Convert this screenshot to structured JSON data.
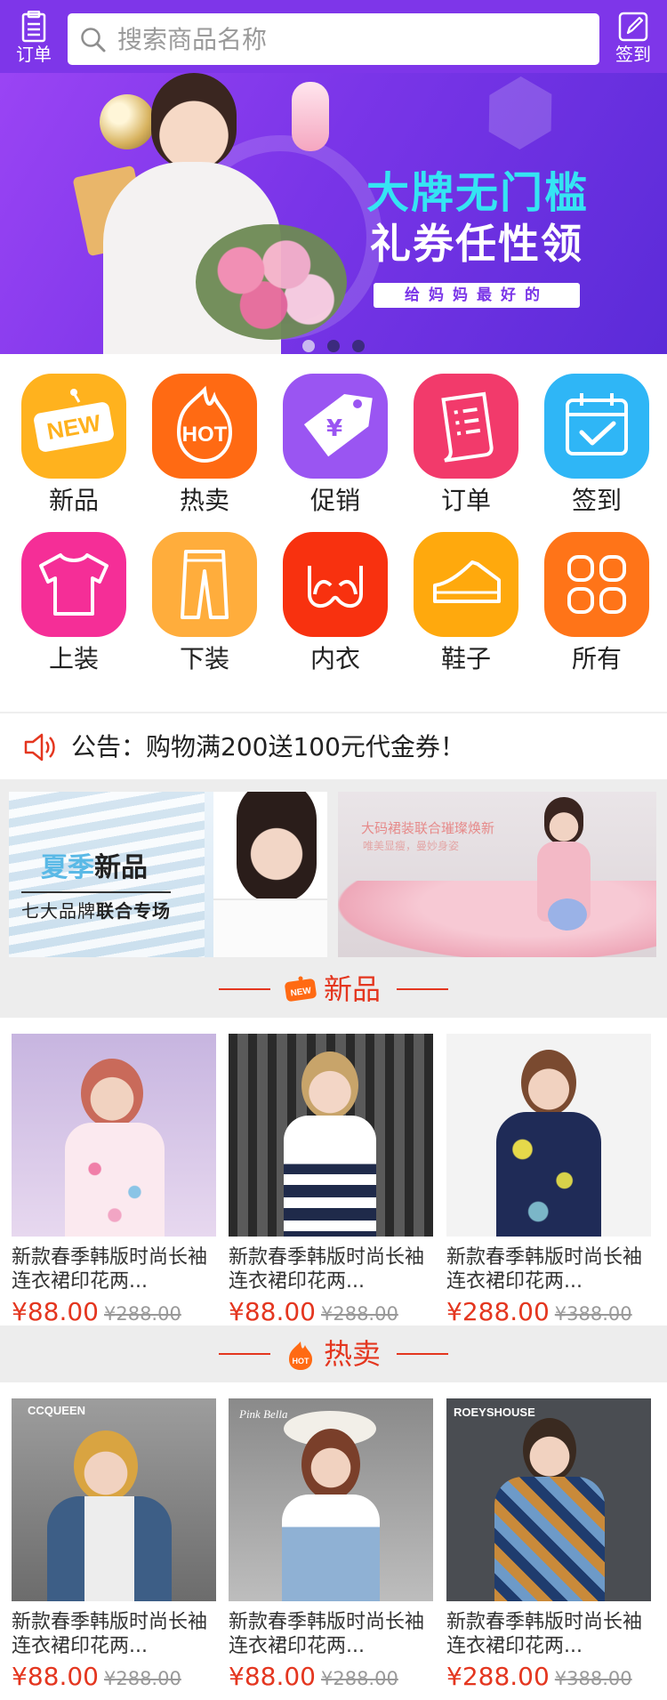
{
  "header": {
    "orders_label": "订单",
    "checkin_label": "签到",
    "search_placeholder": "搜索商品名称"
  },
  "banner": {
    "headline_1": "大牌无门槛",
    "headline_2": "礼券任性领",
    "tagline": "给妈妈最好的",
    "dots": 3,
    "active_dot": 1
  },
  "categories": [
    {
      "label": "新品",
      "icon": "new-badge-icon",
      "color": "#ffb21e"
    },
    {
      "label": "热卖",
      "icon": "hot-flame-icon",
      "color": "#ff6a13"
    },
    {
      "label": "促销",
      "icon": "price-tag-icon",
      "color": "#9a55f2"
    },
    {
      "label": "订单",
      "icon": "order-list-icon",
      "color": "#f23a6b"
    },
    {
      "label": "签到",
      "icon": "calendar-check-icon",
      "color": "#2fb6f6"
    },
    {
      "label": "上装",
      "icon": "tshirt-icon",
      "color": "#f52e97"
    },
    {
      "label": "下装",
      "icon": "pants-icon",
      "color": "#ffad3c"
    },
    {
      "label": "内衣",
      "icon": "bra-icon",
      "color": "#f8310f"
    },
    {
      "label": "鞋子",
      "icon": "shoe-icon",
      "color": "#ffa90d"
    },
    {
      "label": "所有",
      "icon": "all-grid-icon",
      "color": "#ff7418"
    }
  ],
  "notice": {
    "text": "公告：购物满200送100元代金券！"
  },
  "promos": {
    "left": {
      "season": "夏季",
      "title": "新品",
      "subtitle_a": "七大品牌",
      "subtitle_b": "联合专场"
    },
    "right": {
      "headline": "大码裙装联合璀璨焕新",
      "subline": "唯美显瘦，曼妙身姿"
    }
  },
  "sections": {
    "new": {
      "title": "新品",
      "badge": "NEW"
    },
    "hot": {
      "title": "热卖",
      "badge": "HOT"
    }
  },
  "new_products": [
    {
      "title": "新款春季韩版时尚长袖连衣裙印花两...",
      "price": "¥88.00",
      "old_price": "¥288.00"
    },
    {
      "title": "新款春季韩版时尚长袖连衣裙印花两...",
      "price": "¥88.00",
      "old_price": "¥288.00"
    },
    {
      "title": "新款春季韩版时尚长袖连衣裙印花两...",
      "price": "¥288.00",
      "old_price": "¥388.00"
    }
  ],
  "hot_products": [
    {
      "title": "新款春季韩版时尚长袖连衣裙印花两...",
      "price": "¥88.00",
      "old_price": "¥288.00",
      "brand": "CCQUEEN"
    },
    {
      "title": "新款春季韩版时尚长袖连衣裙印花两...",
      "price": "¥88.00",
      "old_price": "¥288.00",
      "brand": "Pink Bella"
    },
    {
      "title": "新款春季韩版时尚长袖连衣裙印花两...",
      "price": "¥288.00",
      "old_price": "¥388.00",
      "brand": "ROEYSHOUSE"
    }
  ]
}
